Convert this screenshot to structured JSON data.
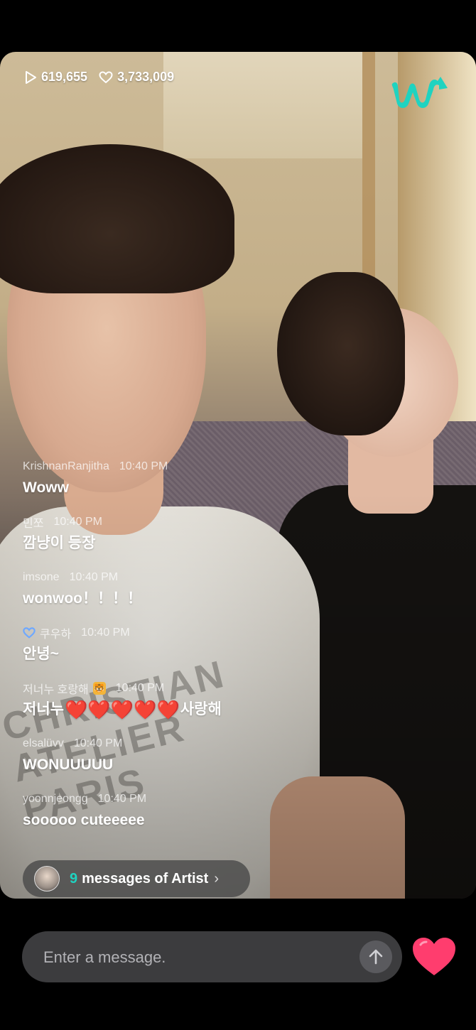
{
  "stats": {
    "views": "619,655",
    "likes": "3,733,009"
  },
  "brand": {
    "logo_icon": "weverse-w-logo",
    "accent": "#1fd3c0"
  },
  "chat": [
    {
      "user": "KrishnanRanjitha",
      "time": "10:40 PM",
      "text": "Woww"
    },
    {
      "user": "민쪼",
      "time": "10:40 PM",
      "text": "깜냥이 등장"
    },
    {
      "user": "imsone",
      "time": "10:40 PM",
      "text": "wonwoo！！！！"
    },
    {
      "user": "쿠우하",
      "time": "10:40 PM",
      "text": "안녕~",
      "badge": "heart-badge-icon"
    },
    {
      "user": "저너누 호랑해",
      "time": "10:40 PM",
      "text_before": "저너누",
      "hearts": "❤️❤️❤️❤️❤️",
      "text_after": "사랑해",
      "user_emoji": "tiger-icon"
    },
    {
      "user": "elsalüvv",
      "time": "10:40 PM",
      "text": "WONUUUUU"
    },
    {
      "user": "yoonnjeongg",
      "time": "10:40 PM",
      "text": "sooooo cuteeeee"
    }
  ],
  "artist_messages": {
    "count": "9",
    "label": "messages of Artist"
  },
  "input": {
    "placeholder": "Enter a message."
  },
  "icons": {
    "send": "arrow-up-icon",
    "like": "heart-icon"
  },
  "colors": {
    "like": "#ff3d6e",
    "input_bg": "#3c3c3e"
  }
}
